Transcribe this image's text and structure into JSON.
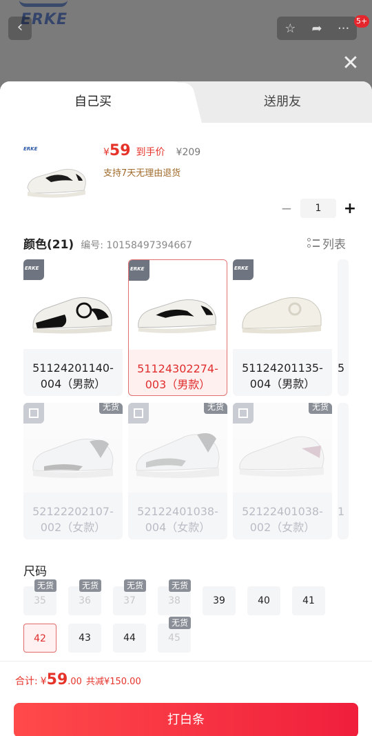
{
  "background": {
    "brand": "ERKE",
    "message_badge": "5+"
  },
  "tabs": [
    {
      "label": "自己买"
    },
    {
      "label": "送朋友"
    }
  ],
  "product": {
    "price_symbol": "¥",
    "price": "59",
    "price_tag": "到手价",
    "original_price": "¥209",
    "return_policy": "支持7天无理由退货",
    "thumb_brand": "ERKE",
    "quantity": "1"
  },
  "color_section": {
    "title": "颜色(21)",
    "code": "编号: 10158497394667",
    "list_toggle": "列表"
  },
  "colors": [
    {
      "label": "51124201140-004（男款）",
      "brand": "ERKE",
      "out_of_stock": false
    },
    {
      "label": "51124302274-003（男款）",
      "brand": "ERKE",
      "out_of_stock": false,
      "selected": true
    },
    {
      "label": "51124201135-004（男款）",
      "brand": "ERKE",
      "out_of_stock": false
    },
    {
      "label": "5",
      "out_of_stock": false
    },
    {
      "label": "52122202107-002（女款）",
      "out_of_stock": true,
      "tag": "无货"
    },
    {
      "label": "52122401038-004（女款）",
      "out_of_stock": true,
      "tag": "无货"
    },
    {
      "label": "52122401038-002（女款）",
      "out_of_stock": true,
      "tag": "无货"
    },
    {
      "label": "1",
      "out_of_stock": false
    }
  ],
  "size_section": {
    "title": "尺码"
  },
  "sizes": [
    {
      "label": "35",
      "tag": "无货"
    },
    {
      "label": "36",
      "tag": "无货"
    },
    {
      "label": "37",
      "tag": "无货"
    },
    {
      "label": "38",
      "tag": "无货"
    },
    {
      "label": "39"
    },
    {
      "label": "40"
    },
    {
      "label": "41"
    },
    {
      "label": "42",
      "selected": true
    },
    {
      "label": "43"
    },
    {
      "label": "44"
    },
    {
      "label": "45",
      "tag": "无货"
    }
  ],
  "footer": {
    "total_label": "合计:",
    "total_symbol": "¥",
    "total_int": "59",
    "total_dec": ".00",
    "discount": "共减¥150.00",
    "cta": "打白条"
  },
  "colors_theme": {
    "accent": "#e6332a",
    "cta_start": "#ff4a4a",
    "cta_end": "#f01f3c"
  }
}
